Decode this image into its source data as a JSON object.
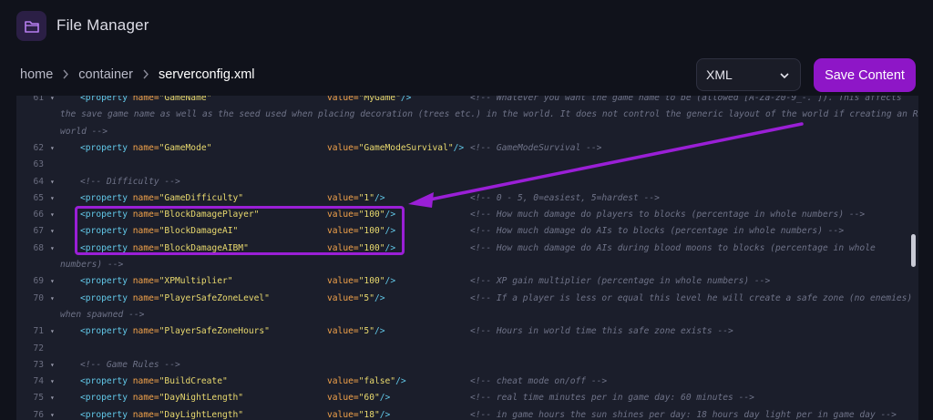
{
  "app": {
    "title": "File Manager"
  },
  "breadcrumb": {
    "items": [
      "home",
      "container",
      "serverconfig.xml"
    ]
  },
  "toolbar": {
    "language_value": "XML",
    "save_label": "Save Content"
  },
  "editor": {
    "lines": [
      {
        "n": "61",
        "fold": true,
        "xml": "<property name=\"GameName\"",
        "val": "value=\"MyGame\"/>",
        "cmt": "<!-- Whatever you want the game name to be (allowed [A-Za-z0-9_-. ]). This affects"
      },
      {
        "n": "",
        "cont": "the save game name as well as the seed used when placing decoration (trees etc.) in the world. It does not control the generic layout of the world if creating an RWG"
      },
      {
        "n": "",
        "cont": "world -->"
      },
      {
        "n": "62",
        "fold": true,
        "xml": "<property name=\"GameMode\"",
        "val": "value=\"GameModeSurvival\"/>",
        "cmt": "<!-- GameModeSurvival -->"
      },
      {
        "n": "63",
        "fold": false
      },
      {
        "n": "64",
        "fold": true,
        "xml": "<!-- Difficulty -->"
      },
      {
        "n": "65",
        "fold": true,
        "xml": "<property name=\"GameDifficulty\"",
        "val": "value=\"1\"/>",
        "cmt": "<!-- 0 - 5, 0=easiest, 5=hardest -->"
      },
      {
        "n": "66",
        "fold": true,
        "xml": "<property name=\"BlockDamagePlayer\"",
        "val": "value=\"100\"/>",
        "cmt": "<!-- How much damage do players to blocks (percentage in whole numbers) -->"
      },
      {
        "n": "67",
        "fold": true,
        "xml": "<property name=\"BlockDamageAI\"",
        "val": "value=\"100\"/>",
        "cmt": "<!-- How much damage do AIs to blocks (percentage in whole numbers) -->"
      },
      {
        "n": "68",
        "fold": true,
        "xml": "<property name=\"BlockDamageAIBM\"",
        "val": "value=\"100\"/>",
        "cmt": "<!-- How much damage do AIs during blood moons to blocks (percentage in whole"
      },
      {
        "n": "",
        "cont": "numbers) -->"
      },
      {
        "n": "69",
        "fold": true,
        "xml": "<property name=\"XPMultiplier\"",
        "val": "value=\"100\"/>",
        "cmt": "<!-- XP gain multiplier (percentage in whole numbers) -->"
      },
      {
        "n": "70",
        "fold": true,
        "xml": "<property name=\"PlayerSafeZoneLevel\"",
        "val": "value=\"5\"/>",
        "cmt": "<!-- If a player is less or equal this level he will create a safe zone (no enemies)"
      },
      {
        "n": "",
        "cont": "when spawned -->"
      },
      {
        "n": "71",
        "fold": true,
        "xml": "<property name=\"PlayerSafeZoneHours\"",
        "val": "value=\"5\"/>",
        "cmt": "<!-- Hours in world time this safe zone exists -->"
      },
      {
        "n": "72",
        "fold": false
      },
      {
        "n": "73",
        "fold": true,
        "xml": "<!-- Game Rules -->"
      },
      {
        "n": "74",
        "fold": true,
        "xml": "<property name=\"BuildCreate\"",
        "val": "value=\"false\"/>",
        "cmt": "<!-- cheat mode on/off -->"
      },
      {
        "n": "75",
        "fold": true,
        "xml": "<property name=\"DayNightLength\"",
        "val": "value=\"60\"/>",
        "cmt": "<!-- real time minutes per in game day: 60 minutes -->"
      },
      {
        "n": "76",
        "fold": true,
        "xml": "<property name=\"DayLightLength\"",
        "val": "value=\"18\"/>",
        "cmt": "<!-- in game hours the sun shines per day: 18 hours day light per in game day -->"
      }
    ]
  },
  "colors": {
    "accent": "#8e16c7",
    "highlight": "#9a1fd6",
    "tag": "#62c8e8",
    "attr": "#f2a24a",
    "string": "#e9d96e",
    "comment": "#6f7388"
  },
  "icons": {
    "logo": "folder-icon",
    "separator": "chevron-right-icon",
    "select": "chevron-down-icon",
    "fold": "fold-arrow-icon"
  }
}
